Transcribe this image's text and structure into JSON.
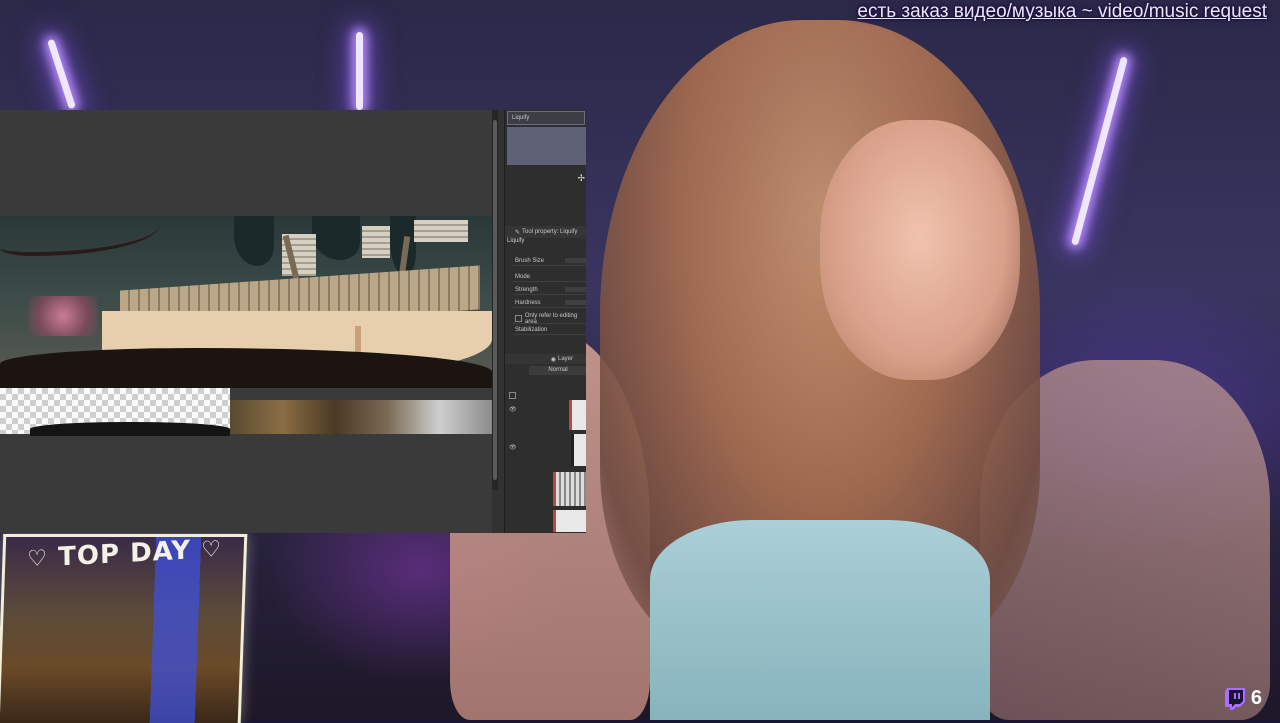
{
  "overlay": {
    "request_banner": "есть заказ видео/музыка ~ video/music request",
    "viewer_count": "6",
    "viewer_icon": "twitch-icon",
    "topday_label": "TOP DAY",
    "topday_icon": "heart-icon"
  },
  "app": {
    "palette_title": "Liquify",
    "tool_property_title": "Tool property: Liquify",
    "tool_name": "Liquify",
    "properties": [
      "Brush Size",
      "Mode",
      "Strength",
      "Hardness",
      "Only refer to editing area",
      "Stabilization"
    ],
    "layer_tab": "Layer",
    "blend_mode": "Normal",
    "colors": {
      "panel_bg": "#2e2e2e",
      "canvas_bg": "#3a3a3a",
      "accent": "#6a6d7a"
    }
  }
}
